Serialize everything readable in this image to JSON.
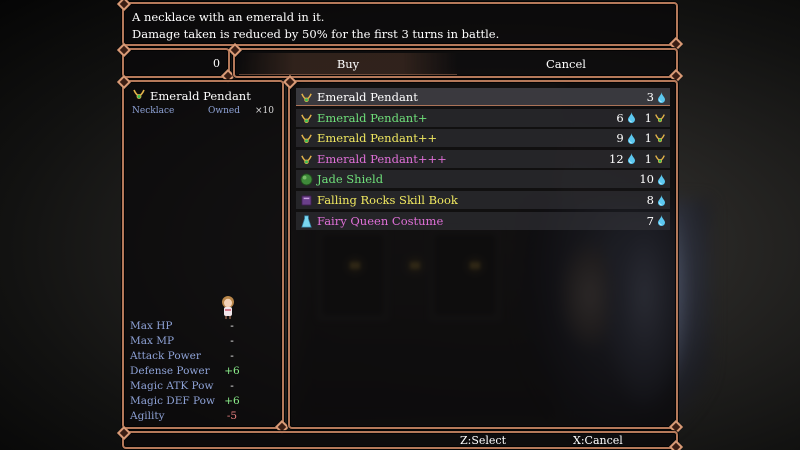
{
  "help": {
    "line1": "A necklace with an emerald in it.",
    "line2": "Damage taken is reduced by 50% for the first 3 turns in battle."
  },
  "gold": {
    "value": "0"
  },
  "commands": {
    "buy": "Buy",
    "cancel": "Cancel"
  },
  "status": {
    "item_name": "Emerald Pendant",
    "category": "Necklace",
    "owned_label": "Owned",
    "owned_count": "×10",
    "stats": [
      {
        "label": "Max HP",
        "value": "-",
        "color": "#ffffff"
      },
      {
        "label": "Max MP",
        "value": "-",
        "color": "#ffffff"
      },
      {
        "label": "Attack Power",
        "value": "-",
        "color": "#ffffff"
      },
      {
        "label": "Defense Power",
        "value": "+6",
        "color": "#8cf08c"
      },
      {
        "label": "Magic ATK Pow",
        "value": "-",
        "color": "#ffffff"
      },
      {
        "label": "Magic DEF Pow",
        "value": "+6",
        "color": "#8cf08c"
      },
      {
        "label": "Agility",
        "value": "-5",
        "color": "#e88080"
      }
    ]
  },
  "items": [
    {
      "name": "Emerald Pendant",
      "color": "#ffffff",
      "icon": "necklace-icon",
      "price": "3",
      "extra": ""
    },
    {
      "name": "Emerald Pendant+",
      "color": "#6fe07a",
      "icon": "necklace-icon",
      "price": "6",
      "extra": "1"
    },
    {
      "name": "Emerald Pendant++",
      "color": "#f0e860",
      "icon": "necklace-icon",
      "price": "9",
      "extra": "1"
    },
    {
      "name": "Emerald Pendant+++",
      "color": "#e070d8",
      "icon": "necklace-icon",
      "price": "12",
      "extra": "1"
    },
    {
      "name": "Jade Shield",
      "color": "#6fe07a",
      "icon": "shield-icon",
      "price": "10",
      "extra": ""
    },
    {
      "name": "Falling Rocks Skill Book",
      "color": "#f0e860",
      "icon": "book-icon",
      "price": "8",
      "extra": ""
    },
    {
      "name": "Fairy Queen Costume",
      "color": "#e070d8",
      "icon": "dress-icon",
      "price": "7",
      "extra": ""
    }
  ],
  "footer": {
    "select_hint": "Z:Select",
    "cancel_hint": "X:Cancel"
  }
}
